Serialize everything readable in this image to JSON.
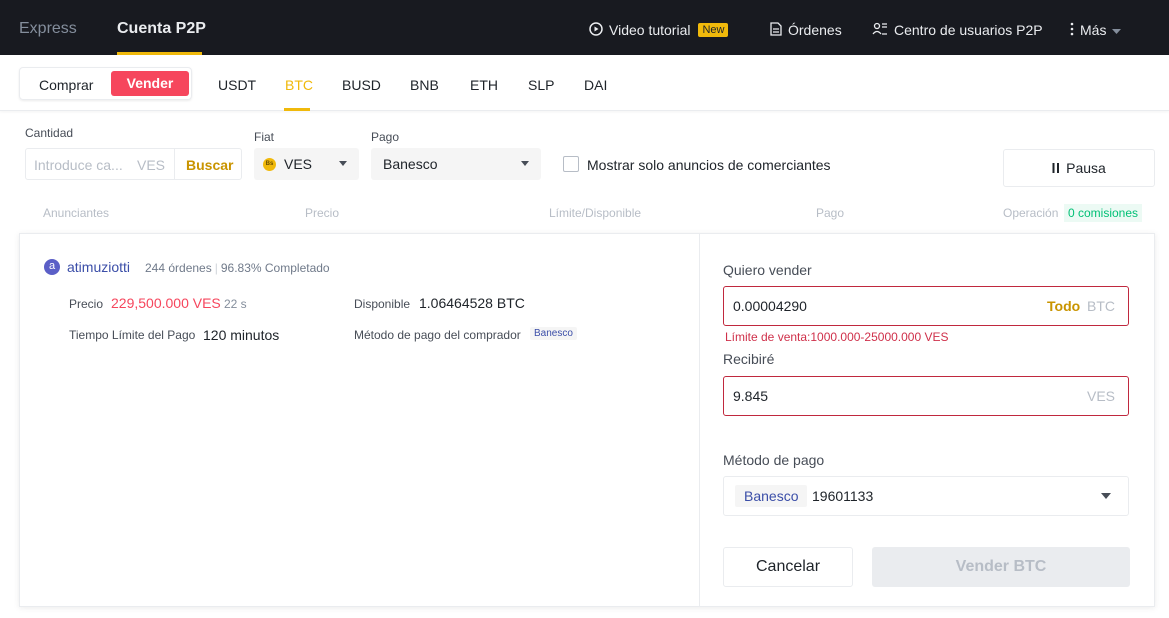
{
  "topbar": {
    "tabs": [
      "Express",
      "Cuenta P2P"
    ],
    "video_tutorial": "Video tutorial",
    "new_badge": "New",
    "orders": "Órdenes",
    "user_center": "Centro de usuarios P2P",
    "more": "Más"
  },
  "trade_toggle": {
    "buy": "Comprar",
    "sell": "Vender"
  },
  "coins": [
    "USDT",
    "BTC",
    "BUSD",
    "BNB",
    "ETH",
    "SLP",
    "DAI"
  ],
  "active_coin": "BTC",
  "filters": {
    "amount_label": "Cantidad",
    "amount_placeholder": "Introduce ca...",
    "amount_unit": "VES",
    "search_label": "Buscar",
    "fiat_label": "Fiat",
    "fiat_value": "VES",
    "fiat_icon_text": "Bs",
    "payment_label": "Pago",
    "payment_value": "Banesco",
    "merchant_only_label": "Mostrar solo anuncios de comerciantes",
    "pause_label": "Pausa"
  },
  "table_headers": {
    "advertisers": "Anunciantes",
    "price": "Precio",
    "limit": "Límite/Disponible",
    "payment": "Pago",
    "operation": "Operación",
    "zero_fee": "0 comisiones"
  },
  "ad": {
    "avatar_letter": "a",
    "user": "atimuziotti",
    "orders": "244 órdenes",
    "completion": "96.83% Completado",
    "price_label": "Precio",
    "price": "229,500.000 VES",
    "price_age": "22 s",
    "available_label": "Disponible",
    "available": "1.06464528 BTC",
    "time_limit_label": "Tiempo Límite del Pago",
    "time_limit": "120 minutos",
    "buyer_payment_label": "Método de pago del comprador",
    "buyer_payment": "Banesco"
  },
  "form": {
    "sell_label": "Quiero vender",
    "sell_value": "0.00004290",
    "all_label": "Todo",
    "sell_unit": "BTC",
    "limit_error": "Límite de venta:1000.000-25000.000 VES",
    "receive_label": "Recibiré",
    "receive_value": "9.845",
    "receive_unit": "VES",
    "payment_method_label": "Método de pago",
    "payment_method_tag": "Banesco",
    "payment_account": "19601133",
    "cancel": "Cancelar",
    "submit": "Vender BTC"
  },
  "colors": {
    "accent": "#f0b90b",
    "sell_red": "#f6465d",
    "topbar_bg": "#181a20",
    "zero_fee_green": "#02c076"
  }
}
